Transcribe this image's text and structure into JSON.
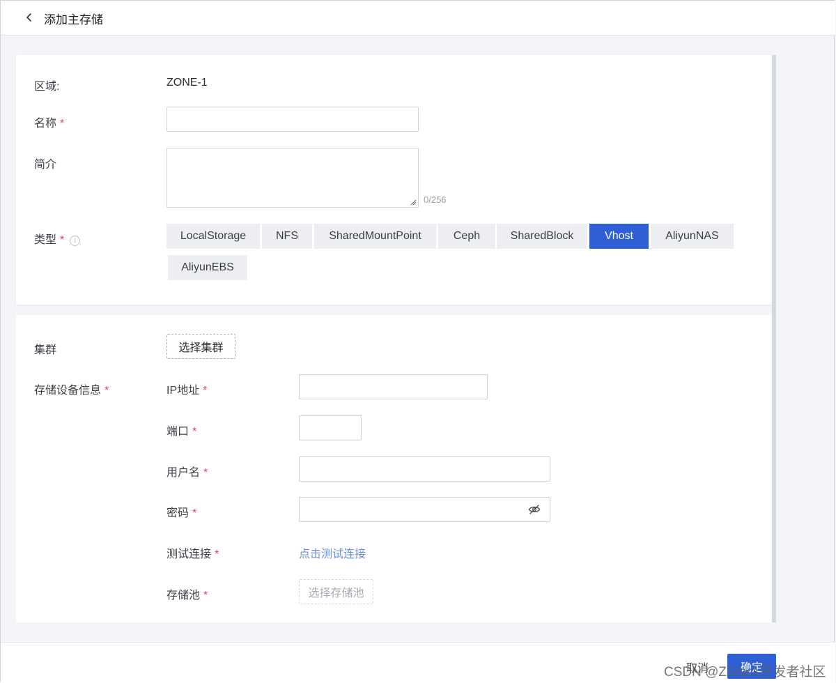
{
  "header": {
    "title": "添加主存储"
  },
  "basic": {
    "zone_label": "区域:",
    "zone_value": "ZONE-1",
    "name_label": "名称",
    "name_value": "",
    "desc_label": "简介",
    "desc_value": "",
    "desc_counter": "0/256",
    "type_label": "类型",
    "required_mark": "*",
    "info_glyph": "i",
    "types": [
      {
        "label": "LocalStorage",
        "selected": false
      },
      {
        "label": "NFS",
        "selected": false
      },
      {
        "label": "SharedMountPoint",
        "selected": false
      },
      {
        "label": "Ceph",
        "selected": false
      },
      {
        "label": "SharedBlock",
        "selected": false
      },
      {
        "label": "Vhost",
        "selected": true
      },
      {
        "label": "AliyunNAS",
        "selected": false
      },
      {
        "label": "AliyunEBS",
        "selected": false
      }
    ]
  },
  "cluster": {
    "label": "集群",
    "select_button": "选择集群"
  },
  "device": {
    "label": "存储设备信息",
    "ip_label": "IP地址",
    "ip_value": "",
    "port_label": "端口",
    "port_value": "",
    "username_label": "用户名",
    "username_value": "",
    "password_label": "密码",
    "password_value": "",
    "test_label": "测试连接",
    "test_link": "点击测试连接",
    "pool_label": "存储池",
    "pool_button": "选择存储池"
  },
  "footer": {
    "cancel": "取消",
    "confirm": "确定",
    "watermark": "CSDN @ZStack开发者社区"
  },
  "colors": {
    "accent": "#2f5fd4",
    "required": "#e2434b",
    "link": "#6d8fd8"
  },
  "icons": [
    "chevron-left-icon",
    "info-icon",
    "eye-off-icon",
    "resize-grip-icon"
  ]
}
